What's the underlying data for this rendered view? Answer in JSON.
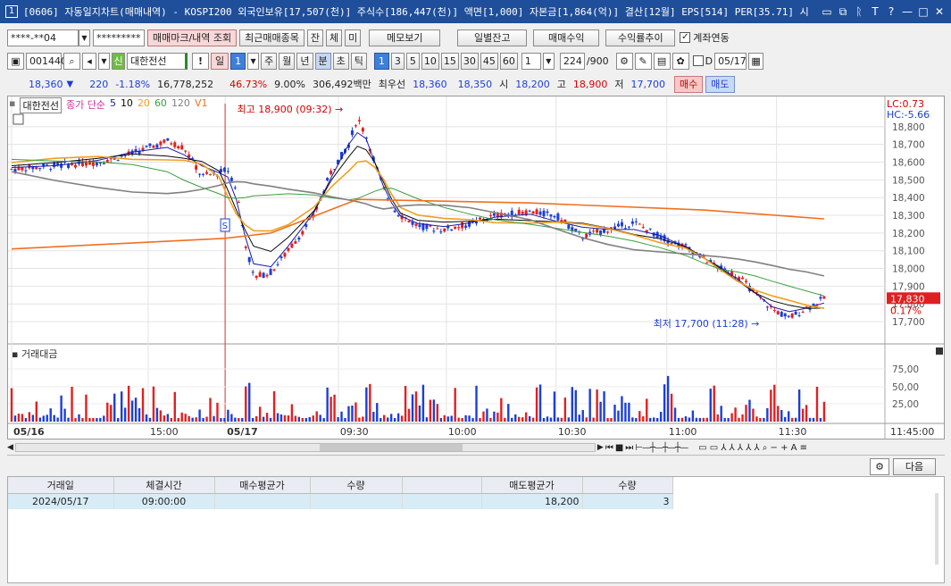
{
  "window": {
    "number": "1",
    "title": "[0606] 자동일지차트(매매내역) - KOSPI200 외국인보유[17,507(천)] 주식수[186,447(천)] 액면[1,000] 자본금[1,864(억)] 결산[12월] EPS[514] PER[35.71] 시",
    "buttons": [
      "▭",
      "⧉",
      "ᚱ",
      "T",
      "?",
      "—",
      "□",
      "✕"
    ]
  },
  "toolbar1": {
    "account": "****-**04",
    "password": "*********",
    "btn_trade_marks": "매매마크/내역 조회",
    "btn_recent": "최근매매종목",
    "btn_jan": "잔",
    "btn_che": "체",
    "btn_mi": "미",
    "btn_memo": "메모보기",
    "btn_daily_balance": "일별잔고",
    "btn_profit": "매매수익",
    "btn_profit_trend": "수익률추이",
    "acct_link_label": "계좌연동"
  },
  "toolbar2": {
    "code": "001440",
    "stock_name": "대한전선",
    "sin": "신",
    "periods": [
      "일",
      "1",
      "주",
      "월",
      "년",
      "분",
      "초",
      "틱"
    ],
    "minutes": [
      "1",
      "3",
      "5",
      "10",
      "15",
      "30",
      "45",
      "60"
    ],
    "select_value": "1",
    "count": "224",
    "count_total": "/900",
    "date_label": "D",
    "date": "05/17"
  },
  "quote": {
    "price": "18,360",
    "change": "220",
    "rate": "-1.18%",
    "volume": "16,778,252",
    "ratio": "46.73%",
    "turnover": "9.00%",
    "amount": "306,492백만",
    "best_label": "최우선",
    "ask": "18,360",
    "bid": "18,350",
    "open_label": "시",
    "open": "18,200",
    "high_label": "고",
    "high": "18,900",
    "low_label": "저",
    "low": "17,700",
    "buy_btn": "매수",
    "sell_btn": "매도"
  },
  "chart_info": {
    "name": "대한전선",
    "ma_label": "종가 단순",
    "ma_periods": [
      "5",
      "10",
      "20",
      "60",
      "120"
    ],
    "v1": "V1"
  },
  "chart_data": {
    "type": "line",
    "price_axis": [
      "18,800",
      "18,700",
      "18,600",
      "18,500",
      "18,400",
      "18,300",
      "18,200",
      "18,100",
      "18,000",
      "17,900",
      "17,800",
      "17,700"
    ],
    "ylim": [
      17650,
      18900
    ],
    "lc": "LC:0.73",
    "hc": "HC:-5.66",
    "current_price": "17,830",
    "current_rate": "0.17%",
    "high_annotation": "최고 18,900 (09:32)",
    "low_annotation": "최저 17,700 (11:28)",
    "s_marker": "S",
    "time_labels": [
      "05/16",
      "15:00",
      "05/17",
      "09:30",
      "10:00",
      "10:30",
      "11:00",
      "11:30",
      "11:45:00"
    ],
    "volume_title": "거래대금",
    "volume_axis": [
      "75,00",
      "50,00",
      "25,00"
    ],
    "ma_colors": {
      "ma5": "#1a1aa8",
      "ma10": "#0a0a0a",
      "ma20": "#f0a020",
      "ma60": "#3aa040",
      "ma120": "#808080",
      "ma240": "#f07020"
    },
    "series": [
      {
        "x": [
          0,
          0.05,
          0.1,
          0.14,
          0.18,
          0.2,
          0.22,
          0.24,
          0.25,
          0.26,
          0.27,
          0.28,
          0.3,
          0.32,
          0.35,
          0.37,
          0.39,
          0.4,
          0.41,
          0.42,
          0.43,
          0.44,
          0.45,
          0.47,
          0.5,
          0.53,
          0.56,
          0.6,
          0.63,
          0.66,
          0.69,
          0.72,
          0.75,
          0.78,
          0.8,
          0.82,
          0.84,
          0.86,
          0.88,
          0.9,
          0.92,
          0.94
        ],
        "values": [
          18560,
          18580,
          18600,
          18650,
          18720,
          18680,
          18520,
          18540,
          18560,
          18450,
          18150,
          17950,
          17980,
          18100,
          18300,
          18550,
          18700,
          18850,
          18750,
          18600,
          18450,
          18350,
          18300,
          18240,
          18220,
          18250,
          18300,
          18320,
          18300,
          18180,
          18220,
          18260,
          18180,
          18120,
          18060,
          18000,
          17960,
          17860,
          17770,
          17720,
          17780,
          17830
        ]
      }
    ]
  },
  "bottom": {
    "next_btn": "다음"
  },
  "grid": {
    "columns": [
      "거래일",
      "체결시간",
      "매수평균가",
      "수량",
      "",
      "매도평균가",
      "수량"
    ],
    "rows": [
      [
        "2024/05/17",
        "09:00:00",
        "",
        "",
        "",
        "18,200",
        "3"
      ]
    ]
  }
}
